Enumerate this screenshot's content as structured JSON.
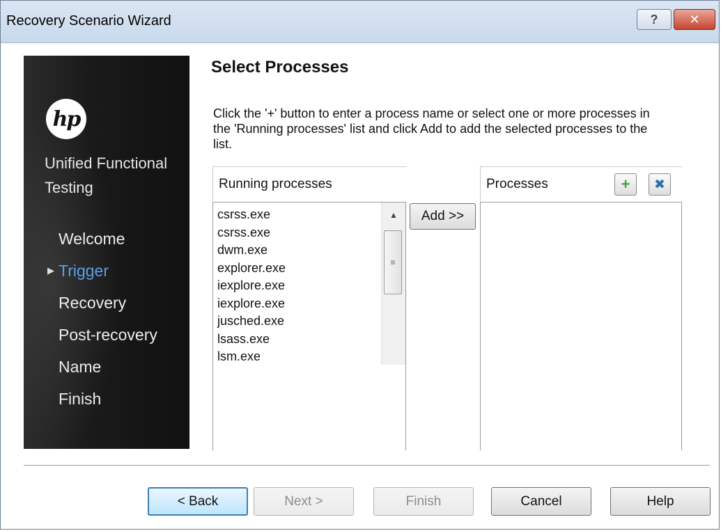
{
  "window": {
    "title": "Recovery Scenario Wizard",
    "help_glyph": "?",
    "close_glyph": "✕"
  },
  "sidebar": {
    "logo_text": "hp",
    "product_name": "Unified Functional Testing",
    "items": [
      {
        "label": "Welcome",
        "active": false
      },
      {
        "label": "Trigger",
        "active": true
      },
      {
        "label": "Recovery",
        "active": false
      },
      {
        "label": "Post-recovery",
        "active": false
      },
      {
        "label": "Name",
        "active": false
      },
      {
        "label": "Finish",
        "active": false
      }
    ]
  },
  "page": {
    "heading": "Select Processes",
    "instructions": "Click the '+' button to enter a process name or select one or more processes in the 'Running processes' list and click Add to add the selected processes to the list."
  },
  "running_processes": {
    "header": "Running processes",
    "items": [
      "csrss.exe",
      "csrss.exe",
      "dwm.exe",
      "explorer.exe",
      "iexplore.exe",
      "iexplore.exe",
      "jusched.exe",
      "lsass.exe",
      "lsm.exe"
    ]
  },
  "add_button": {
    "label": "Add >>"
  },
  "processes": {
    "header": "Processes",
    "items": [],
    "add_icon": "plus-icon",
    "remove_icon": "delete-x-icon"
  },
  "footer": {
    "back": "< Back",
    "next": "Next >",
    "finish": "Finish",
    "cancel": "Cancel",
    "help": "Help"
  },
  "colors": {
    "active_nav": "#5a9fe8",
    "titlebar": "#c9d9ec",
    "close_button": "#c7442f"
  }
}
